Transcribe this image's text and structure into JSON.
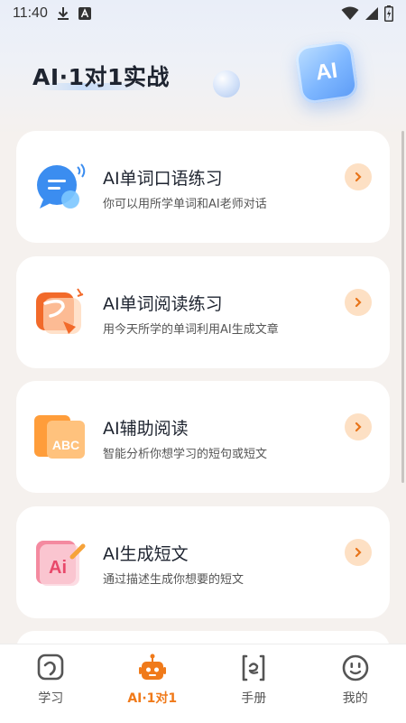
{
  "status_bar": {
    "time": "11:40",
    "left_icons": [
      "download-icon",
      "a-icon"
    ],
    "right_icons": [
      "wifi-icon",
      "signal-icon",
      "battery-icon"
    ]
  },
  "header": {
    "title": "AI·1对1实战",
    "badge_text": "AI"
  },
  "cards": [
    {
      "title": "AI单词口语练习",
      "desc": "你可以用所学单词和AI老师对话",
      "icon": "chat-bubble-icon"
    },
    {
      "title": "AI单词阅读练习",
      "desc": "用今天所学的单词利用AI生成文章",
      "icon": "pen-book-icon"
    },
    {
      "title": "AI辅助阅读",
      "desc": "智能分析你想学习的短句或短文",
      "icon": "abc-book-icon"
    },
    {
      "title": "AI生成短文",
      "desc": "通过描述生成你想要的短文",
      "icon": "ai-notebook-icon"
    }
  ],
  "tabbar": {
    "tabs": [
      {
        "label": "学习",
        "icon": "study-icon",
        "active": false
      },
      {
        "label": "AI·1对1",
        "icon": "robot-icon",
        "active": true
      },
      {
        "label": "手册",
        "icon": "handbook-icon",
        "active": false
      },
      {
        "label": "我的",
        "icon": "profile-icon",
        "active": false
      }
    ]
  },
  "colors": {
    "accent": "#f07a1a",
    "chevron_bg": "#fde0c4",
    "background": "#f5f1ee",
    "card": "#ffffff"
  }
}
